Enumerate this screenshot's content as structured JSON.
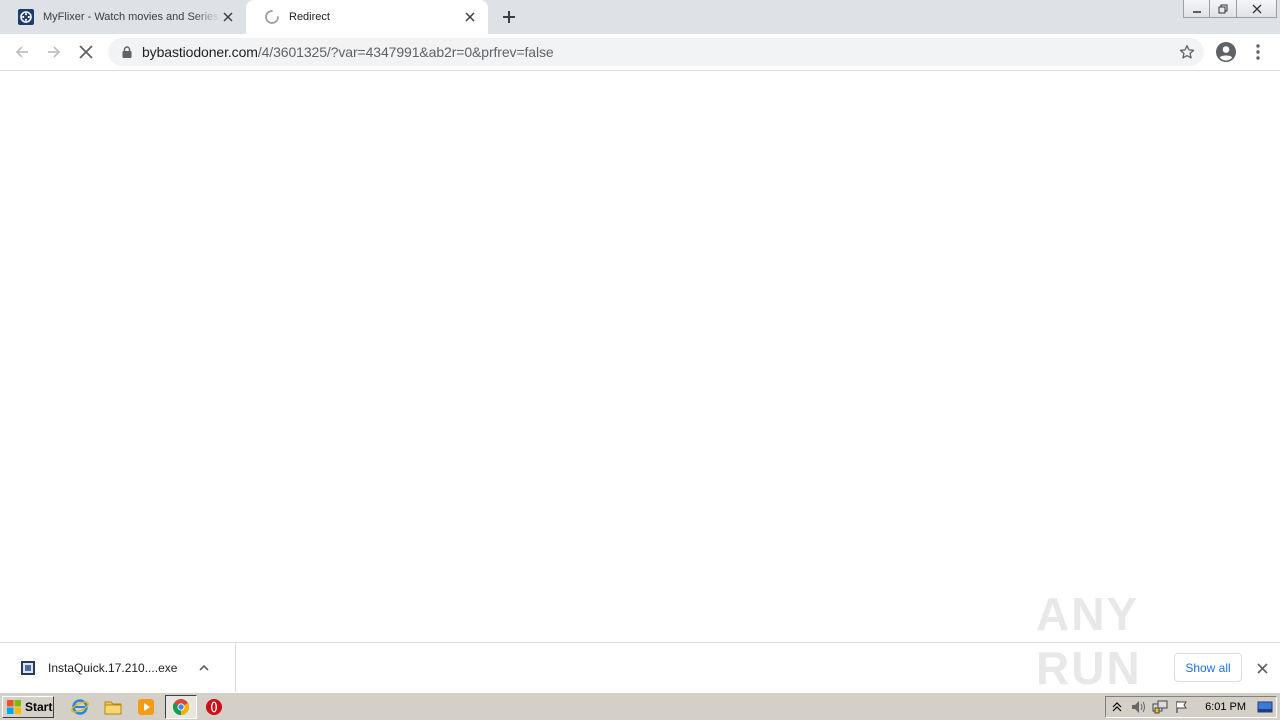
{
  "browser": {
    "tabs": [
      {
        "title": "MyFlixer - Watch movies and Series online",
        "favicon": "film-reel-icon",
        "active": false
      },
      {
        "title": "Redirect",
        "favicon": "loading-spinner-icon",
        "active": true
      }
    ],
    "address": {
      "host": "bybastiodoner.com",
      "path": "/4/3601325/?var=4347991&ab2r=0&prfrev=false"
    }
  },
  "downloads": {
    "item": {
      "filename": "InstaQuick.17.210....exe"
    },
    "show_all_label": "Show all"
  },
  "watermark": {
    "text": "ANY RUN"
  },
  "taskbar": {
    "start_label": "Start",
    "clock": "6:01 PM"
  },
  "colors": {
    "accent": "#1a73e8",
    "tabstrip": "#dee1e6",
    "taskbar": "#d4d0c8"
  }
}
